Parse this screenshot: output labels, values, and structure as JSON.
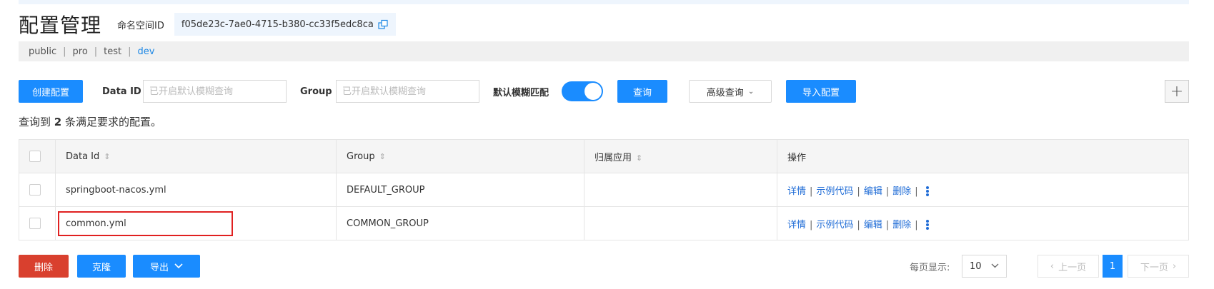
{
  "header": {
    "title": "配置管理",
    "namespace_label": "命名空间ID",
    "namespace_id": "f05de23c-7ae0-4715-b380-cc33f5edc8ca"
  },
  "namespaces": {
    "items": [
      "public",
      "pro",
      "test",
      "dev"
    ],
    "active": "dev",
    "separator": "|"
  },
  "toolbar": {
    "create_label": "创建配置",
    "dataid_label": "Data ID",
    "dataid_placeholder": "已开启默认模糊查询",
    "group_label": "Group",
    "group_placeholder": "已开启默认模糊查询",
    "fuzzy_label": "默认模糊匹配",
    "fuzzy_on": true,
    "query_label": "查询",
    "advanced_label": "高级查询",
    "import_label": "导入配置",
    "plus_label": "+"
  },
  "result": {
    "prefix": "查询到",
    "count": "2",
    "suffix": "条满足要求的配置。"
  },
  "table": {
    "headers": [
      "Data Id",
      "Group",
      "归属应用",
      "操作"
    ],
    "rows": [
      {
        "data_id": "springboot-nacos.yml",
        "group": "DEFAULT_GROUP",
        "app": ""
      },
      {
        "data_id": "common.yml",
        "group": "COMMON_GROUP",
        "app": ""
      }
    ],
    "actions": [
      "详情",
      "示例代码",
      "编辑",
      "删除"
    ]
  },
  "bottom": {
    "delete_label": "删除",
    "clone_label": "克隆",
    "export_label": "导出",
    "page_size_label": "每页显示:",
    "page_size": "10",
    "prev_label": "上一页",
    "current_page": "1",
    "next_label": "下一页"
  },
  "colors": {
    "primary": "#1a8cff",
    "danger": "#d9402e",
    "highlight_border": "#e02020",
    "link": "#1e6bd6"
  }
}
